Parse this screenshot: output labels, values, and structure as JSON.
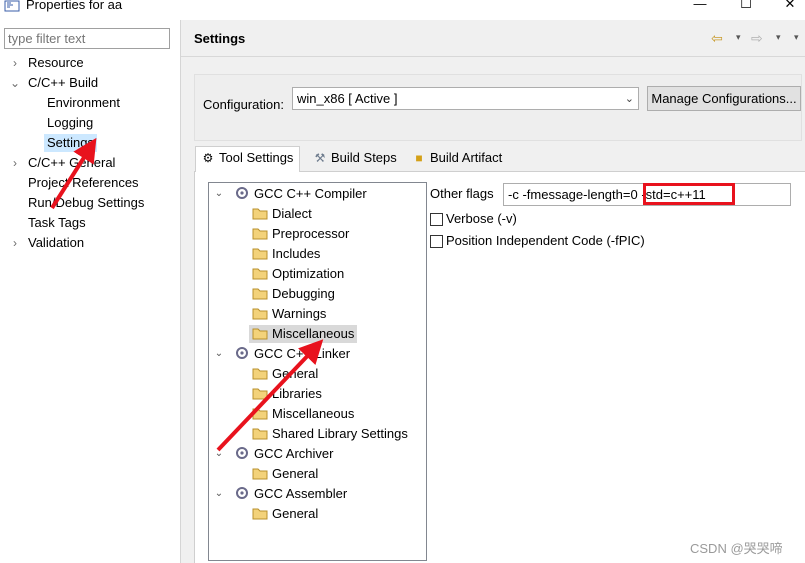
{
  "window": {
    "title": "Properties for aa",
    "minimize_glyph": "—",
    "maximize_glyph": "☐",
    "close_glyph": "✕"
  },
  "sidebar": {
    "filter_placeholder": "type filter text",
    "items": [
      {
        "label": "Resource",
        "toggle": "›"
      },
      {
        "label": "C/C++ Build",
        "toggle": "⌄"
      },
      {
        "label": "Environment",
        "toggle": ""
      },
      {
        "label": "Logging",
        "toggle": ""
      },
      {
        "label": "Settings",
        "toggle": ""
      },
      {
        "label": "C/C++ General",
        "toggle": "›"
      },
      {
        "label": "Project References",
        "toggle": ""
      },
      {
        "label": "Run/Debug Settings",
        "toggle": ""
      },
      {
        "label": "Task Tags",
        "toggle": ""
      },
      {
        "label": "Validation",
        "toggle": "›"
      }
    ],
    "selected": "Settings"
  },
  "header": {
    "title": "Settings",
    "back_glyph": "⇦",
    "forward_glyph": "⇨",
    "menu_glyph": "▾"
  },
  "configuration": {
    "label": "Configuration:",
    "value": "win_x86  [ Active ]",
    "manage_label": "Manage Configurations..."
  },
  "tabs": [
    {
      "label": "Tool Settings",
      "icon": "tool-settings-icon",
      "active": true
    },
    {
      "label": "Build Steps",
      "icon": "build-steps-icon",
      "active": false
    },
    {
      "label": "Build Artifact",
      "icon": "build-artifact-icon",
      "active": false
    }
  ],
  "tool_tree": {
    "groups": [
      {
        "label": "GCC C++ Compiler",
        "children": [
          "Dialect",
          "Preprocessor",
          "Includes",
          "Optimization",
          "Debugging",
          "Warnings",
          "Miscellaneous"
        ]
      },
      {
        "label": "GCC C++ Linker",
        "children": [
          "General",
          "Libraries",
          "Miscellaneous",
          "Shared Library Settings"
        ]
      },
      {
        "label": "GCC Archiver",
        "children": [
          "General"
        ]
      },
      {
        "label": "GCC Assembler",
        "children": [
          "General"
        ]
      }
    ],
    "selected": "Miscellaneous"
  },
  "options": {
    "other_flags_label": "Other flags",
    "other_flags_value": "-c -fmessage-length=0 -std=c++11",
    "verbose_label": "Verbose (-v)",
    "verbose_checked": false,
    "pic_label": "Position Independent Code (-fPIC)",
    "pic_checked": false
  },
  "annotation_color": "#e8121d",
  "selection_color": "#cce8ff",
  "watermark": "CSDN @哭哭啼"
}
